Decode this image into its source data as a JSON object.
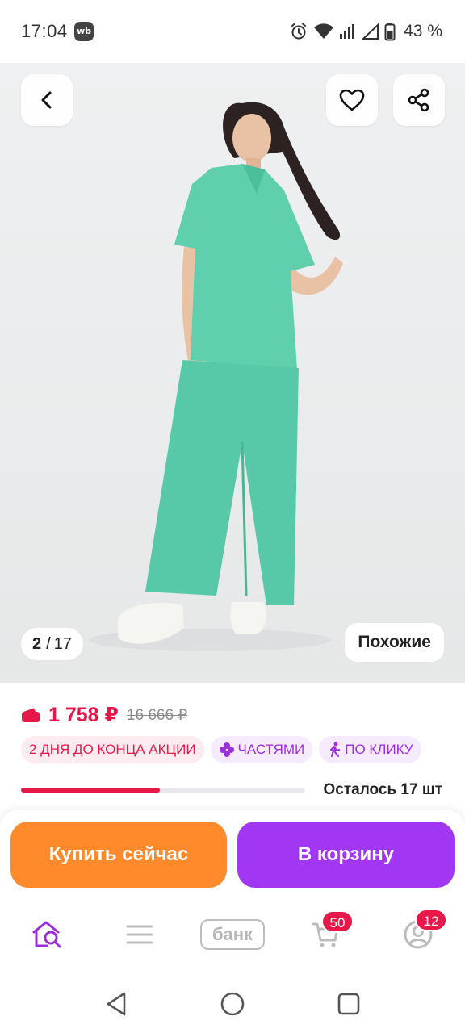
{
  "status_bar": {
    "time": "17:04",
    "app_badge": "wb",
    "battery": "43 %"
  },
  "gallery": {
    "current": "2",
    "separator": "/",
    "total": "17",
    "similar_label": "Похожие"
  },
  "product": {
    "price": "1 758 ₽",
    "old_price": "16 666 ₽",
    "chips": {
      "promo": "2 ДНЯ ДО КОНЦА АКЦИИ",
      "installments": "ЧАСТЯМИ",
      "quick": "ПО КЛИКУ"
    },
    "stock_text": "Осталось 17 шт",
    "stock_fraction": 0.49
  },
  "actions": {
    "buy_now": "Купить сейчас",
    "add_to_cart": "В корзину"
  },
  "bottom_nav": {
    "bank_label": "банк",
    "cart_badge": "50",
    "profile_badge": "12"
  },
  "colors": {
    "accent_red": "#e8174a",
    "buy_orange": "#ff8a2b",
    "cart_purple": "#a137f2",
    "nav_active": "#9b2fd9"
  },
  "icons": {
    "back": "chevron-left-icon",
    "favorite": "heart-icon",
    "share": "share-icon",
    "wallet": "wallet-icon",
    "installments": "clover-icon",
    "quick_buy": "running-man-icon",
    "home": "home-search-icon",
    "catalog": "menu-icon",
    "cart": "cart-icon",
    "profile": "profile-icon"
  }
}
